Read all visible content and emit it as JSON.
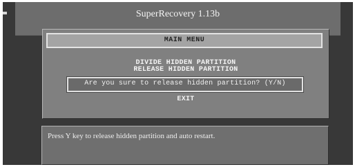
{
  "window": {
    "title": "SuperRecovery 1.13b"
  },
  "menu": {
    "header": "MAIN MENU",
    "items": [
      {
        "label": "DIVIDE HIDDEN PARTITION"
      },
      {
        "label": "RELEASE HIDDEN PARTITION"
      },
      {
        "label": "EXIT"
      }
    ]
  },
  "dialog": {
    "prompt": "Are you sure to release hidden partition? (Y/N)"
  },
  "status": {
    "message": "Press Y key to release hidden partition and auto restart."
  },
  "colors": {
    "background": "#383838",
    "panel": "#808080",
    "text": "#f4f4f4"
  }
}
